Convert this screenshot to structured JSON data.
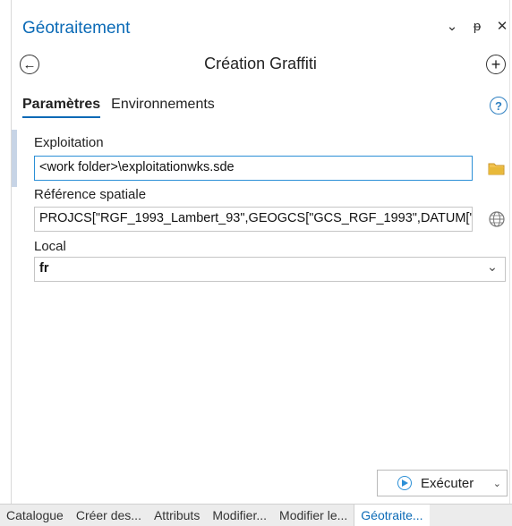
{
  "pane": {
    "title": "Géotraitement",
    "controls": {
      "dropdown": "⌄",
      "pin": "ᵽ",
      "close": "✕"
    }
  },
  "tool": {
    "title": "Création Graffiti",
    "back_icon": "←",
    "add_icon": "+"
  },
  "tabs": [
    {
      "label": "Paramètres",
      "active": true
    },
    {
      "label": "Environnements",
      "active": false
    }
  ],
  "help_icon": "?",
  "params": {
    "exploitation": {
      "label": "Exploitation",
      "value": "<work folder>\\exploitationwks.sde",
      "icon": "folder-icon"
    },
    "spatial_reference": {
      "label": "Référence spatiale",
      "value": "PROJCS[\"RGF_1993_Lambert_93\",GEOGCS[\"GCS_RGF_1993\",DATUM[\"D_RGF_1993\"",
      "icon": "globe-icon"
    },
    "local": {
      "label": "Local",
      "value": "fr",
      "caret": "⌄"
    }
  },
  "run_button": {
    "label": "Exécuter",
    "caret": "⌄"
  },
  "bottom_tabs": [
    {
      "label": "Catalogue",
      "active": false
    },
    {
      "label": "Créer des...",
      "active": false
    },
    {
      "label": "Attributs",
      "active": false
    },
    {
      "label": "Modifier...",
      "active": false
    },
    {
      "label": "Modifier le...",
      "active": false
    },
    {
      "label": "Géotraite...",
      "active": true
    }
  ],
  "colors": {
    "accent": "#0a6ab6",
    "focus": "#2b8fd6",
    "folder": "#e8b93a"
  }
}
